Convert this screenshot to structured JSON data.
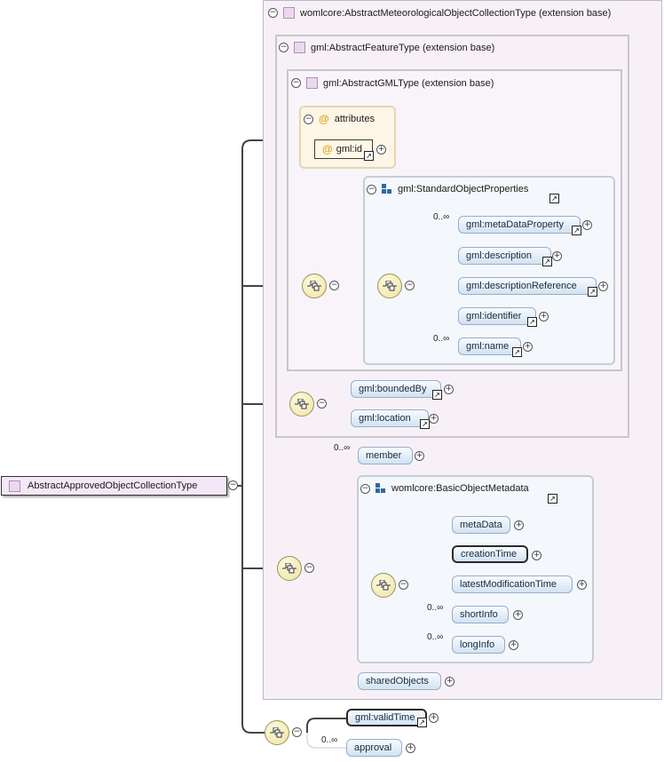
{
  "root": {
    "label": "AbstractApprovedObjectCollectionType"
  },
  "extensions": {
    "outer": {
      "label": "womlcore:AbstractMeteorologicalObjectCollectionType (extension base)"
    },
    "middle": {
      "label": "gml:AbstractFeatureType (extension base)"
    },
    "inner": {
      "label": "gml:AbstractGMLType (extension base)"
    }
  },
  "attributes_group": {
    "label": "attributes",
    "id_attr": "gml:id",
    "at_symbol": "@"
  },
  "groups": {
    "standard_props": {
      "label": "gml:StandardObjectProperties"
    },
    "basic_metadata": {
      "label": "womlcore:BasicObjectMetadata"
    }
  },
  "standard_props_elements": [
    {
      "label": "gml:metaDataProperty",
      "occurs": "0..∞"
    },
    {
      "label": "gml:description",
      "occurs": ""
    },
    {
      "label": "gml:descriptionReference",
      "occurs": ""
    },
    {
      "label": "gml:identifier",
      "occurs": ""
    },
    {
      "label": "gml:name",
      "occurs": "0..∞"
    }
  ],
  "feature_elements": [
    {
      "label": "gml:boundedBy"
    },
    {
      "label": "gml:location"
    }
  ],
  "collection_elements": {
    "member": {
      "label": "member",
      "occurs": "0..∞"
    },
    "shared_objects": {
      "label": "sharedObjects"
    }
  },
  "metadata_elements": [
    {
      "label": "metaData",
      "occurs": ""
    },
    {
      "label": "creationTime",
      "occurs": ""
    },
    {
      "label": "latestModificationTime",
      "occurs": ""
    },
    {
      "label": "shortInfo",
      "occurs": "0..∞"
    },
    {
      "label": "longInfo",
      "occurs": "0..∞"
    }
  ],
  "approved_elements": {
    "valid_time": {
      "label": "gml:validTime"
    },
    "approval": {
      "label": "approval",
      "occurs": "0..∞"
    }
  },
  "symbols": {
    "collapse": "−",
    "expand": "+",
    "reference": "↗"
  },
  "colors": {
    "wire": "#444444",
    "extension_bg": "#f7f1f7",
    "group_bg": "#f4f7fb",
    "attributes_bg": "#fdf6e6",
    "element_fill": "#d2e2f3",
    "compositor_fill": "#ece39f",
    "group_icon": "#2e67a6"
  }
}
